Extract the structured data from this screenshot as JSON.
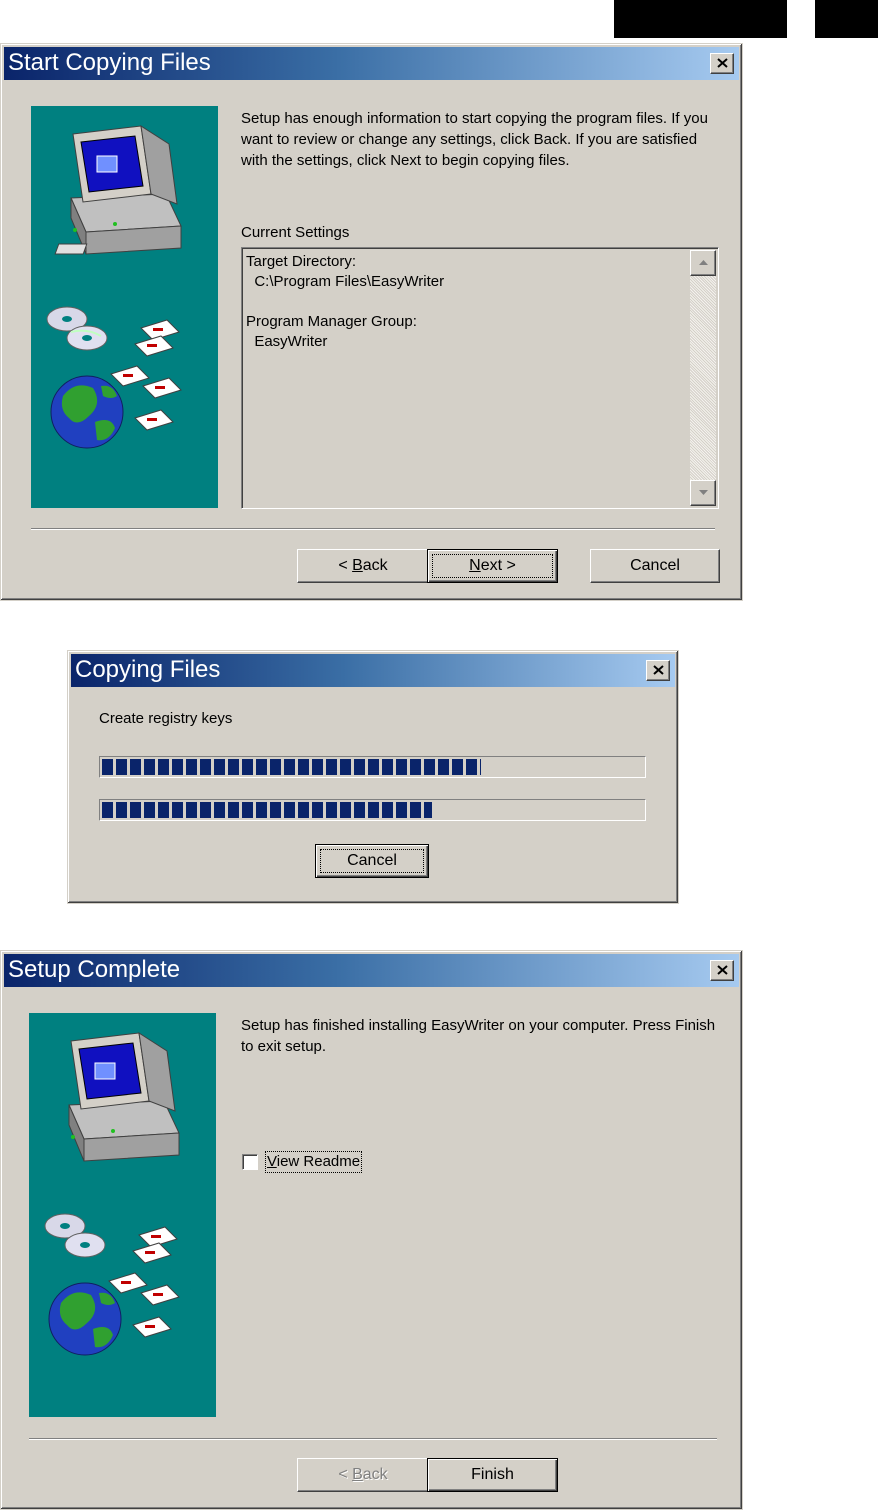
{
  "dialog1": {
    "title": "Start Copying Files",
    "intro": "Setup has enough information to start copying the program files. If you want to review or change any settings, click Back. If you are satisfied with the settings, click Next to begin copying files.",
    "settings_label": "Current Settings",
    "settings_lines": [
      "Target Directory:",
      "  C:\\Program Files\\EasyWriter",
      "",
      "Program Manager Group:",
      "  EasyWriter"
    ],
    "back_label": "< Back",
    "back_key": "B",
    "next_label": "Next >",
    "next_key": "N",
    "cancel_label": "Cancel"
  },
  "dialog2": {
    "title": "Copying Files",
    "status": "Create registry keys",
    "progress_overall": 0.7,
    "progress_file": 0.61,
    "cancel_label": "Cancel"
  },
  "dialog3": {
    "title": "Setup Complete",
    "message": "Setup has finished installing EasyWriter on your computer. Press Finish to exit setup.",
    "checkbox_label": "View Readme",
    "checkbox_checked": false,
    "back_label": "< Back",
    "finish_label": "Finish"
  },
  "icons": [
    "close-icon",
    "computer-icon",
    "cd-icon",
    "floppy-disk-icon",
    "globe-icon",
    "scroll-up-arrow-icon",
    "scroll-down-arrow-icon"
  ]
}
